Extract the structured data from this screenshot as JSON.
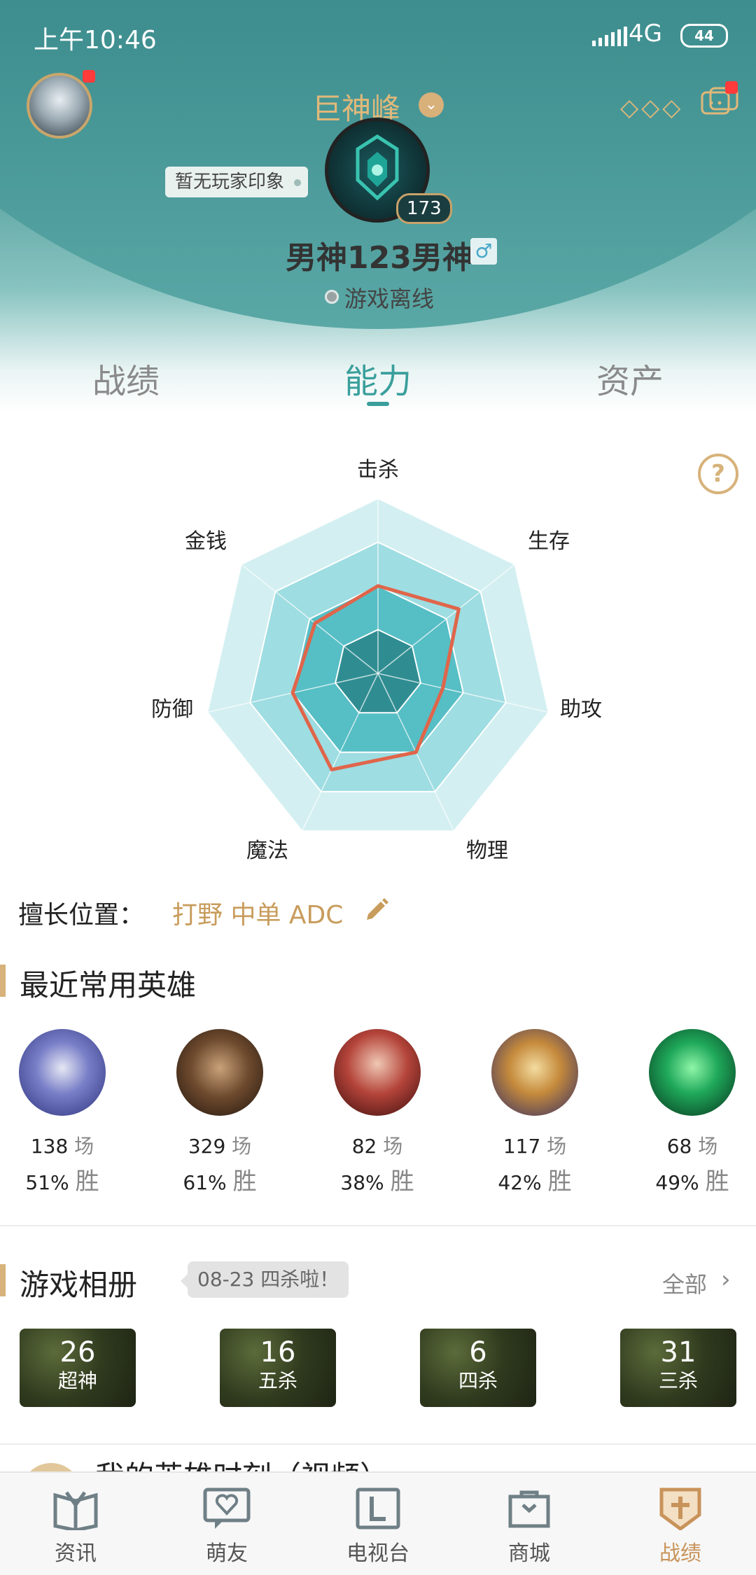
{
  "status_bar": {
    "time": "上午10:46",
    "network": "4G",
    "battery": "44"
  },
  "profile": {
    "summoner_name": "巨神峰",
    "impression": "暂无玩家印象",
    "level": "173",
    "nickname": "男神123男神",
    "gender_symbol": "♂",
    "online_status": "游戏离线"
  },
  "tabs": [
    {
      "label": "战绩"
    },
    {
      "label": "能力"
    },
    {
      "label": "资产"
    }
  ],
  "radar": {
    "labels": {
      "kill": "击杀",
      "survive": "生存",
      "assist": "助攻",
      "physical": "物理",
      "magic": "魔法",
      "defense": "防御",
      "gold": "金钱"
    },
    "values": [
      0.5,
      0.59,
      0.38,
      0.5,
      0.61,
      0.5,
      0.46
    ]
  },
  "position": {
    "label": "擅长位置：",
    "value": "打野 中单 ADC"
  },
  "heroes": {
    "title": "最近常用英雄",
    "items": [
      {
        "games": "138",
        "games_unit": "场",
        "winrate": "51%",
        "win_unit": "胜"
      },
      {
        "games": "329",
        "games_unit": "场",
        "winrate": "61%",
        "win_unit": "胜"
      },
      {
        "games": "82",
        "games_unit": "场",
        "winrate": "38%",
        "win_unit": "胜"
      },
      {
        "games": "117",
        "games_unit": "场",
        "winrate": "42%",
        "win_unit": "胜"
      },
      {
        "games": "68",
        "games_unit": "场",
        "winrate": "49%",
        "win_unit": "胜"
      }
    ]
  },
  "album": {
    "title": "游戏相册",
    "tip": "08-23 四杀啦！",
    "more": "全部",
    "items": [
      {
        "count": "26",
        "name": "超神"
      },
      {
        "count": "16",
        "name": "五杀"
      },
      {
        "count": "6",
        "name": "四杀"
      },
      {
        "count": "31",
        "name": "三杀"
      }
    ]
  },
  "video_section": {
    "title": "我的英雄时刻（视频）"
  },
  "bottom_nav": [
    {
      "label": "资讯"
    },
    {
      "label": "萌友"
    },
    {
      "label": "电视台"
    },
    {
      "label": "商城"
    },
    {
      "label": "战绩"
    }
  ],
  "colors": {
    "accent": "#3a9f9c",
    "gold": "#d7b27a",
    "radar_line": "#e0654a"
  }
}
